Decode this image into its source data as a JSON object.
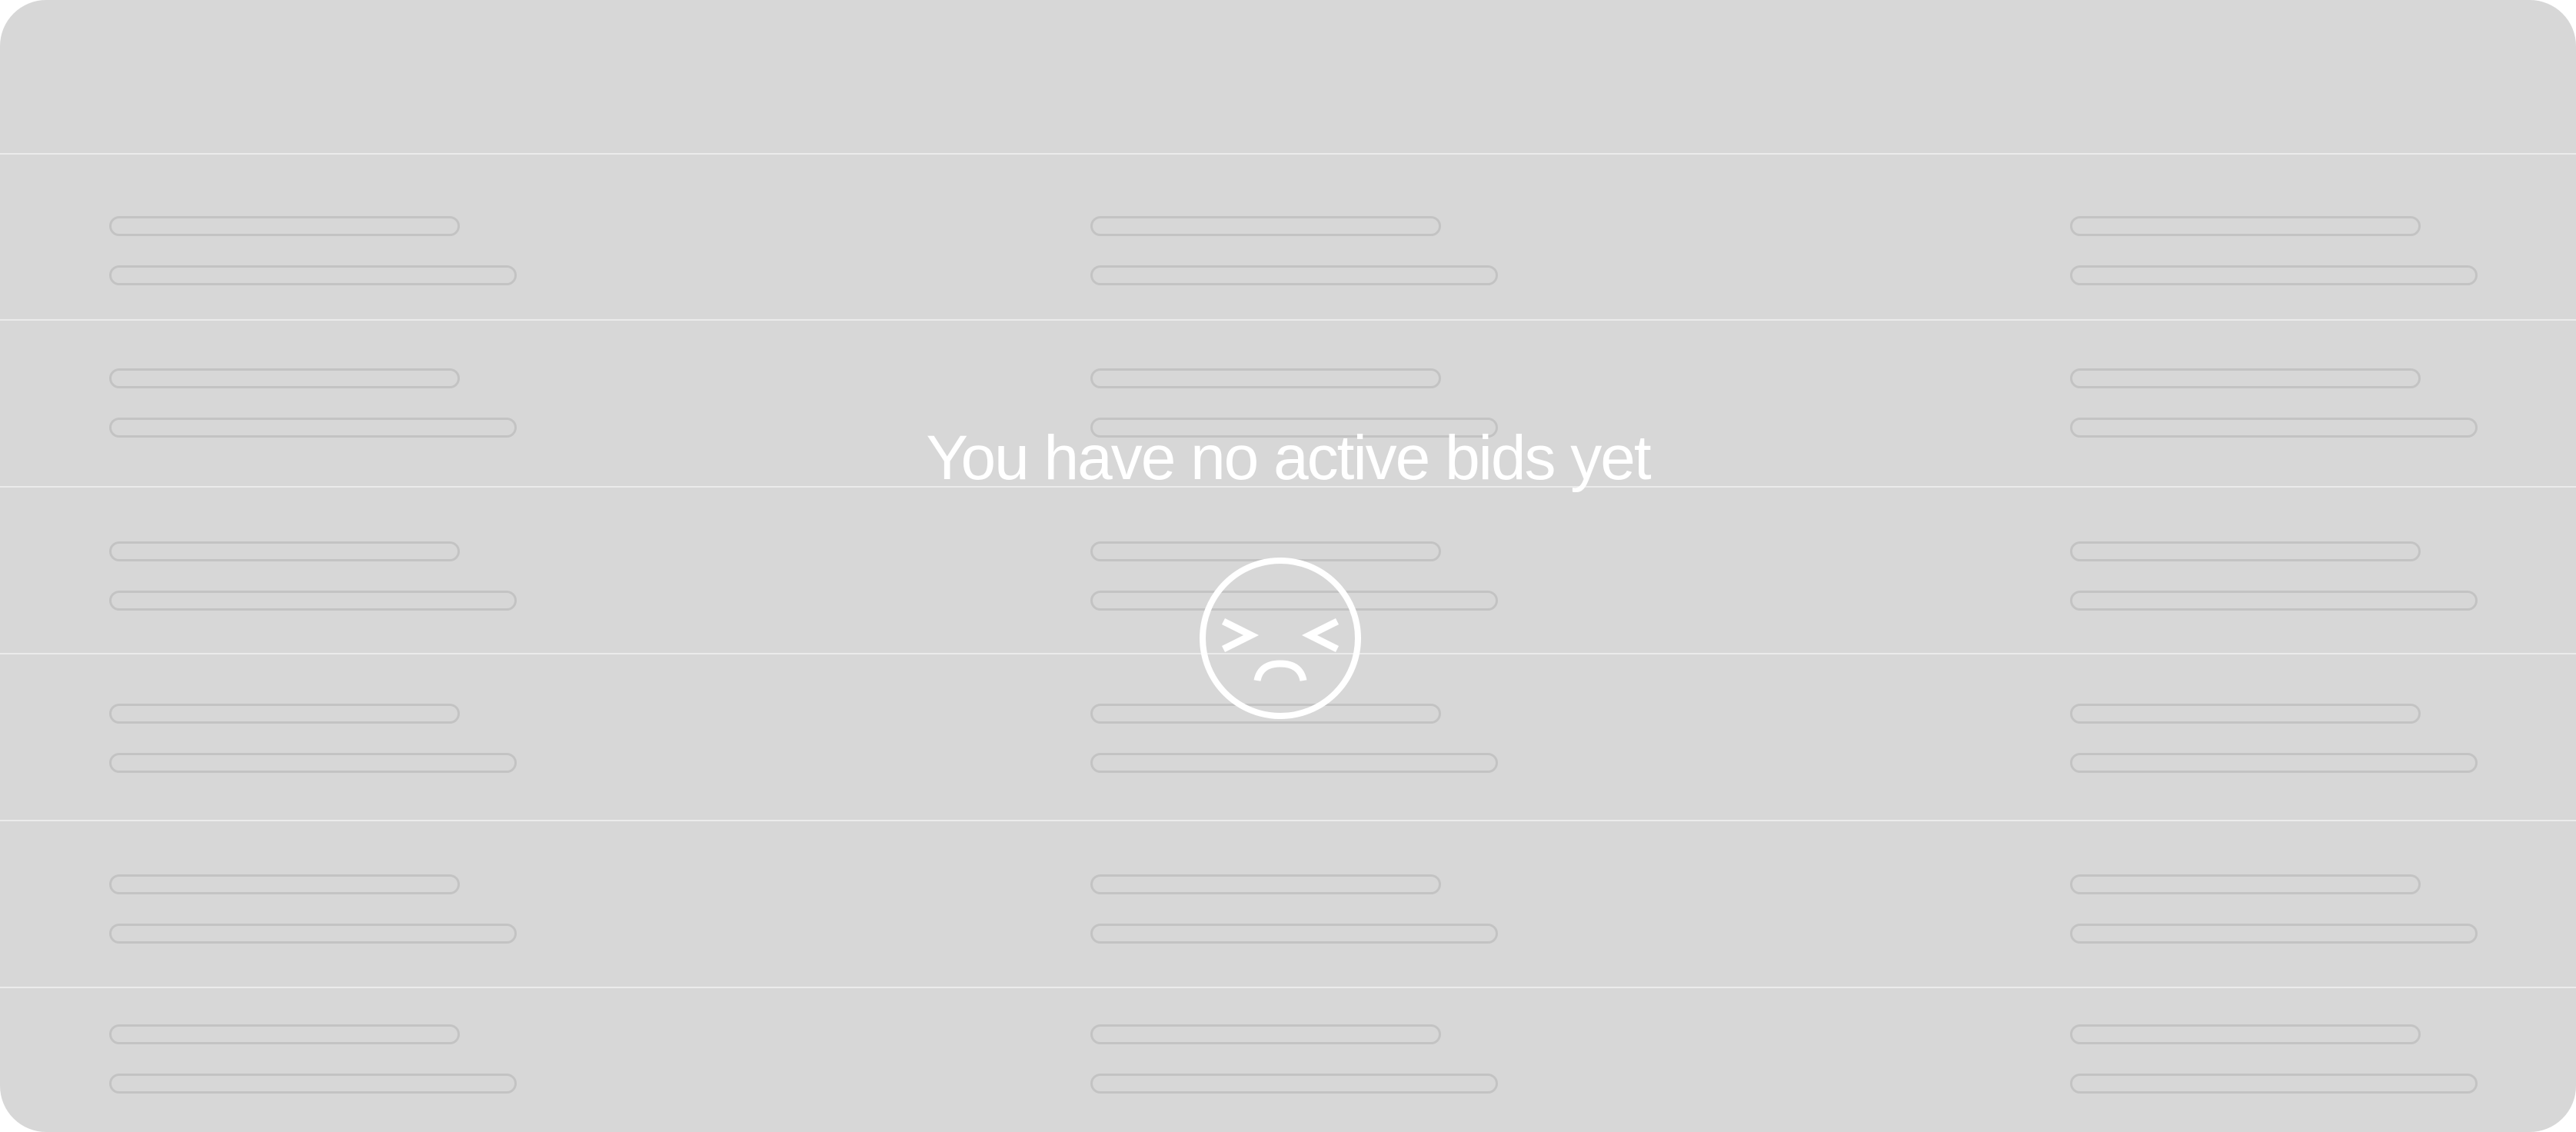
{
  "empty_state": {
    "title": "You have no active bids yet",
    "icon": "sad-face-icon"
  },
  "skeleton": {
    "rows": 6,
    "columns": 3
  },
  "colors": {
    "background": "#d7d7d7",
    "divider": "#ebebeb",
    "placeholder_border": "#c3c3c3",
    "text": "#ffffff"
  }
}
